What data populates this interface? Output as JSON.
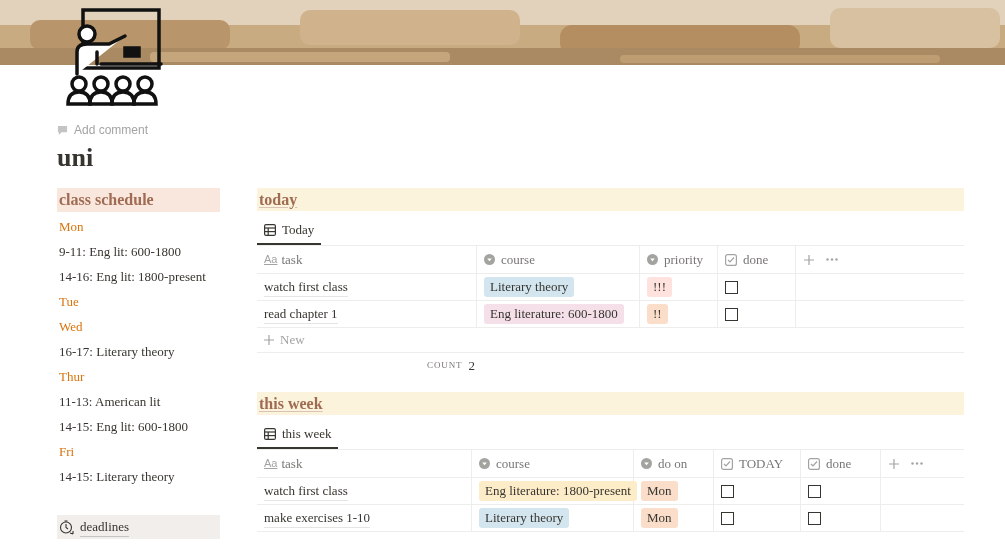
{
  "page": {
    "comment_action": "Add comment",
    "title": "uni"
  },
  "schedule": {
    "title": "class schedule",
    "items": [
      {
        "kind": "day",
        "text": "Mon"
      },
      {
        "kind": "class",
        "text": "9-11: Eng lit: 600-1800"
      },
      {
        "kind": "class",
        "text": "14-16: Eng lit: 1800-present"
      },
      {
        "kind": "day",
        "text": "Tue"
      },
      {
        "kind": "day",
        "text": "Wed"
      },
      {
        "kind": "class",
        "text": "16-17: Literary theory"
      },
      {
        "kind": "day",
        "text": "Thur"
      },
      {
        "kind": "class",
        "text": "11-13: American lit"
      },
      {
        "kind": "class",
        "text": "14-15: Eng lit: 600-1800"
      },
      {
        "kind": "day",
        "text": "Fri"
      },
      {
        "kind": "class",
        "text": "14-15: Literary theory"
      }
    ]
  },
  "deadlines": {
    "title": "deadlines"
  },
  "sections": [
    {
      "title": "today",
      "view": {
        "label": "Today",
        "selected": true
      },
      "columns": [
        {
          "kind": "title",
          "label": "task",
          "icon_text": "Aa"
        },
        {
          "kind": "select",
          "label": "course"
        },
        {
          "kind": "select",
          "label": "priority"
        },
        {
          "kind": "checkbox",
          "label": "done"
        }
      ],
      "rows": [
        [
          {
            "kind": "text",
            "text": "watch first class"
          },
          {
            "kind": "tag",
            "text": "Literary theory",
            "color": "#d3e5ef"
          },
          {
            "kind": "tag",
            "text": "!!!",
            "color": "#ffe2dd"
          },
          {
            "kind": "check",
            "checked": false
          }
        ],
        [
          {
            "kind": "text",
            "text": "read chapter 1"
          },
          {
            "kind": "tag",
            "text": "Eng literature: 600-1800",
            "color": "#f5e0e9"
          },
          {
            "kind": "tag",
            "text": "!!",
            "color": "#fadec9"
          },
          {
            "kind": "check",
            "checked": false
          }
        ]
      ],
      "new_label": "New",
      "count_label": "COUNT",
      "count": "2"
    },
    {
      "title": "this week",
      "view": {
        "label": "this week",
        "selected": true
      },
      "columns": [
        {
          "kind": "title",
          "label": "task",
          "icon_text": "Aa"
        },
        {
          "kind": "select",
          "label": "course"
        },
        {
          "kind": "select",
          "label": "do on"
        },
        {
          "kind": "checkbox",
          "label": "TODAY"
        },
        {
          "kind": "checkbox",
          "label": "done"
        }
      ],
      "rows": [
        [
          {
            "kind": "text",
            "text": "watch first class"
          },
          {
            "kind": "tag",
            "text": "Eng literature: 1800-present",
            "color": "#fdecc8"
          },
          {
            "kind": "tag",
            "text": "Mon",
            "color": "#fadec9"
          },
          {
            "kind": "check",
            "checked": false
          },
          {
            "kind": "check",
            "checked": false
          }
        ],
        [
          {
            "kind": "text",
            "text": "make exercises 1-10"
          },
          {
            "kind": "tag",
            "text": "Literary theory",
            "color": "#d3e5ef"
          },
          {
            "kind": "tag",
            "text": "Mon",
            "color": "#fadec9"
          },
          {
            "kind": "check",
            "checked": false
          },
          {
            "kind": "check",
            "checked": false
          }
        ]
      ]
    }
  ]
}
